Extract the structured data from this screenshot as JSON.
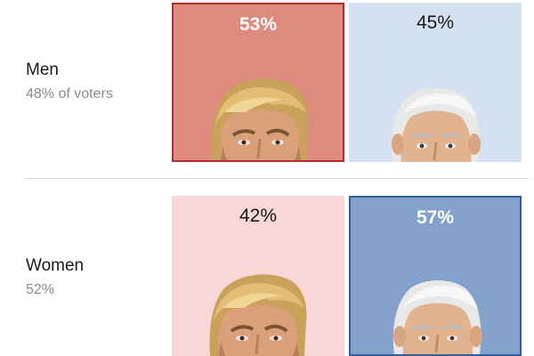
{
  "colors": {
    "trump_win_fill": "#df8a7f",
    "trump_win_border": "#b92b2b",
    "trump_lose_fill": "#f9d7d7",
    "biden_win_fill": "#84a1cb",
    "biden_win_border": "#2f5f9f",
    "biden_lose_fill": "#d5e0f1"
  },
  "rows": [
    {
      "label": "Men",
      "share": "48% of voters",
      "trump": {
        "pct_label": "53%",
        "winner": true
      },
      "biden": {
        "pct_label": "45%",
        "winner": false
      }
    },
    {
      "label": "Women",
      "share": "52%",
      "trump": {
        "pct_label": "42%",
        "winner": false
      },
      "biden": {
        "pct_label": "57%",
        "winner": true
      }
    }
  ],
  "icons": {
    "trump": "trump-portrait-icon",
    "biden": "biden-portrait-icon"
  },
  "chart_data": {
    "type": "table",
    "rows": [
      "Men",
      "Women"
    ],
    "row_shares": [
      "48% of voters",
      "52%"
    ],
    "series": [
      {
        "values": [
          53,
          42
        ]
      },
      {
        "values": [
          45,
          57
        ]
      }
    ],
    "winners": [
      "Trump",
      "Biden"
    ]
  }
}
